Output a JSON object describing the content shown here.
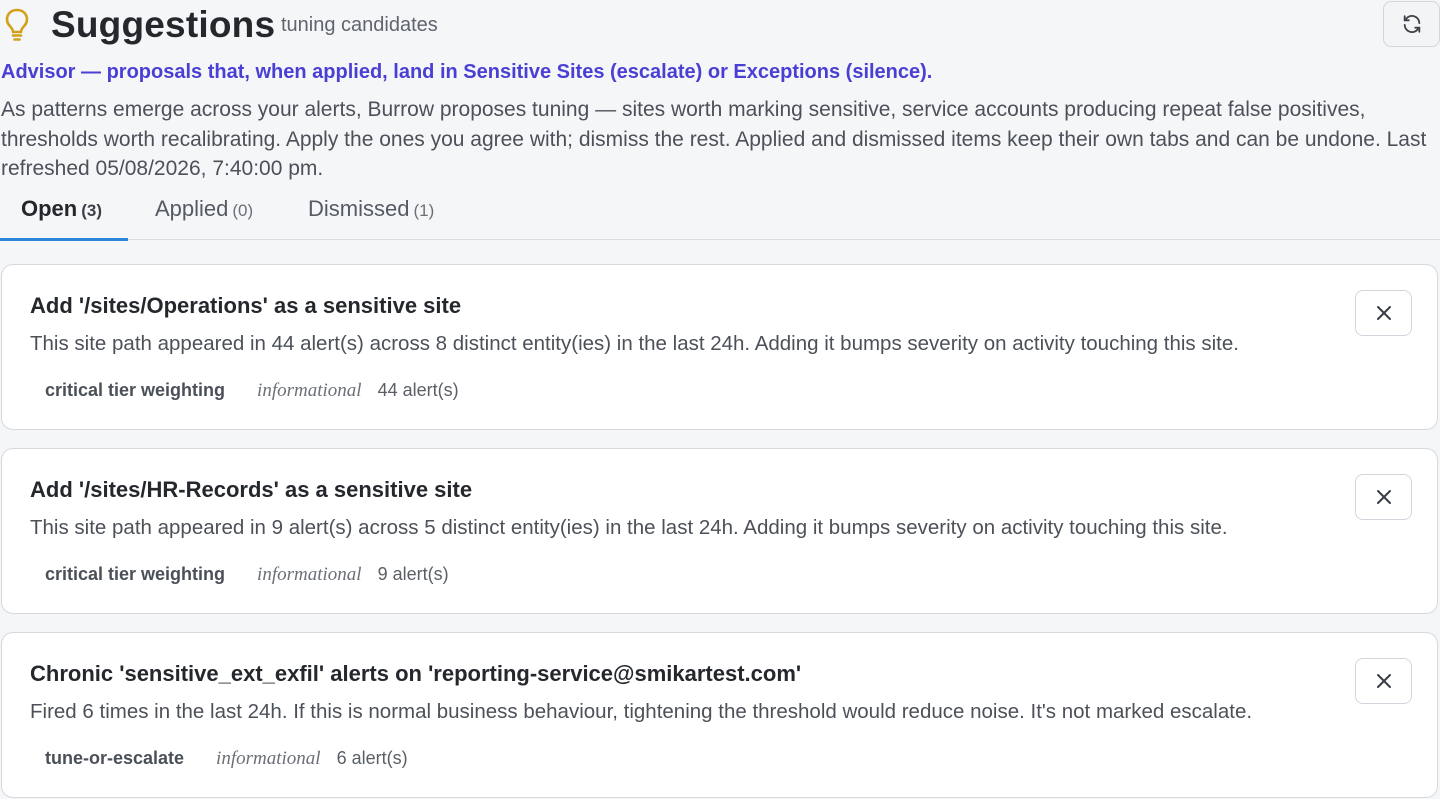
{
  "header": {
    "title": "Suggestions",
    "subtitle": "tuning candidates",
    "icon": "lightbulb-icon",
    "accent_color": "#d4a017"
  },
  "advisor_text": "Advisor — proposals that, when applied, land in Sensitive Sites (escalate) or Exceptions (silence).",
  "description": "As patterns emerge across your alerts, Burrow proposes tuning — sites worth marking sensitive, service accounts producing repeat false positives, thresholds worth recalibrating. Apply the ones you agree with; dismiss the rest. Applied and dismissed items keep their own tabs and can be undone. Last refreshed 05/08/2026, 7:40:00 pm.",
  "tabs": [
    {
      "label": "Open",
      "count": "(3)",
      "active": true
    },
    {
      "label": "Applied",
      "count": "(0)",
      "active": false
    },
    {
      "label": "Dismissed",
      "count": "(1)",
      "active": false
    }
  ],
  "suggestions": [
    {
      "title": "Add '/sites/Operations' as a sensitive site",
      "description": "This site path appeared in 44 alert(s) across 8 distinct entity(ies) in the last 24h. Adding it bumps severity on activity touching this site.",
      "tag": "critical tier weighting",
      "severity": "informational",
      "count": "44 alert(s)"
    },
    {
      "title": "Add '/sites/HR-Records' as a sensitive site",
      "description": "This site path appeared in 9 alert(s) across 5 distinct entity(ies) in the last 24h. Adding it bumps severity on activity touching this site.",
      "tag": "critical tier weighting",
      "severity": "informational",
      "count": "9 alert(s)"
    },
    {
      "title": "Chronic 'sensitive_ext_exfil' alerts on 'reporting-service@smikartest.com'",
      "description": "Fired 6 times in the last 24h. If this is normal business behaviour, tightening the threshold would reduce noise. It's not marked escalate.",
      "tag": "tune-or-escalate",
      "severity": "informational",
      "count": "6 alert(s)"
    }
  ],
  "colors": {
    "advisor_link": "#4a3fd4",
    "tab_underline": "#2f86d8",
    "background": "#f5f6f8"
  }
}
